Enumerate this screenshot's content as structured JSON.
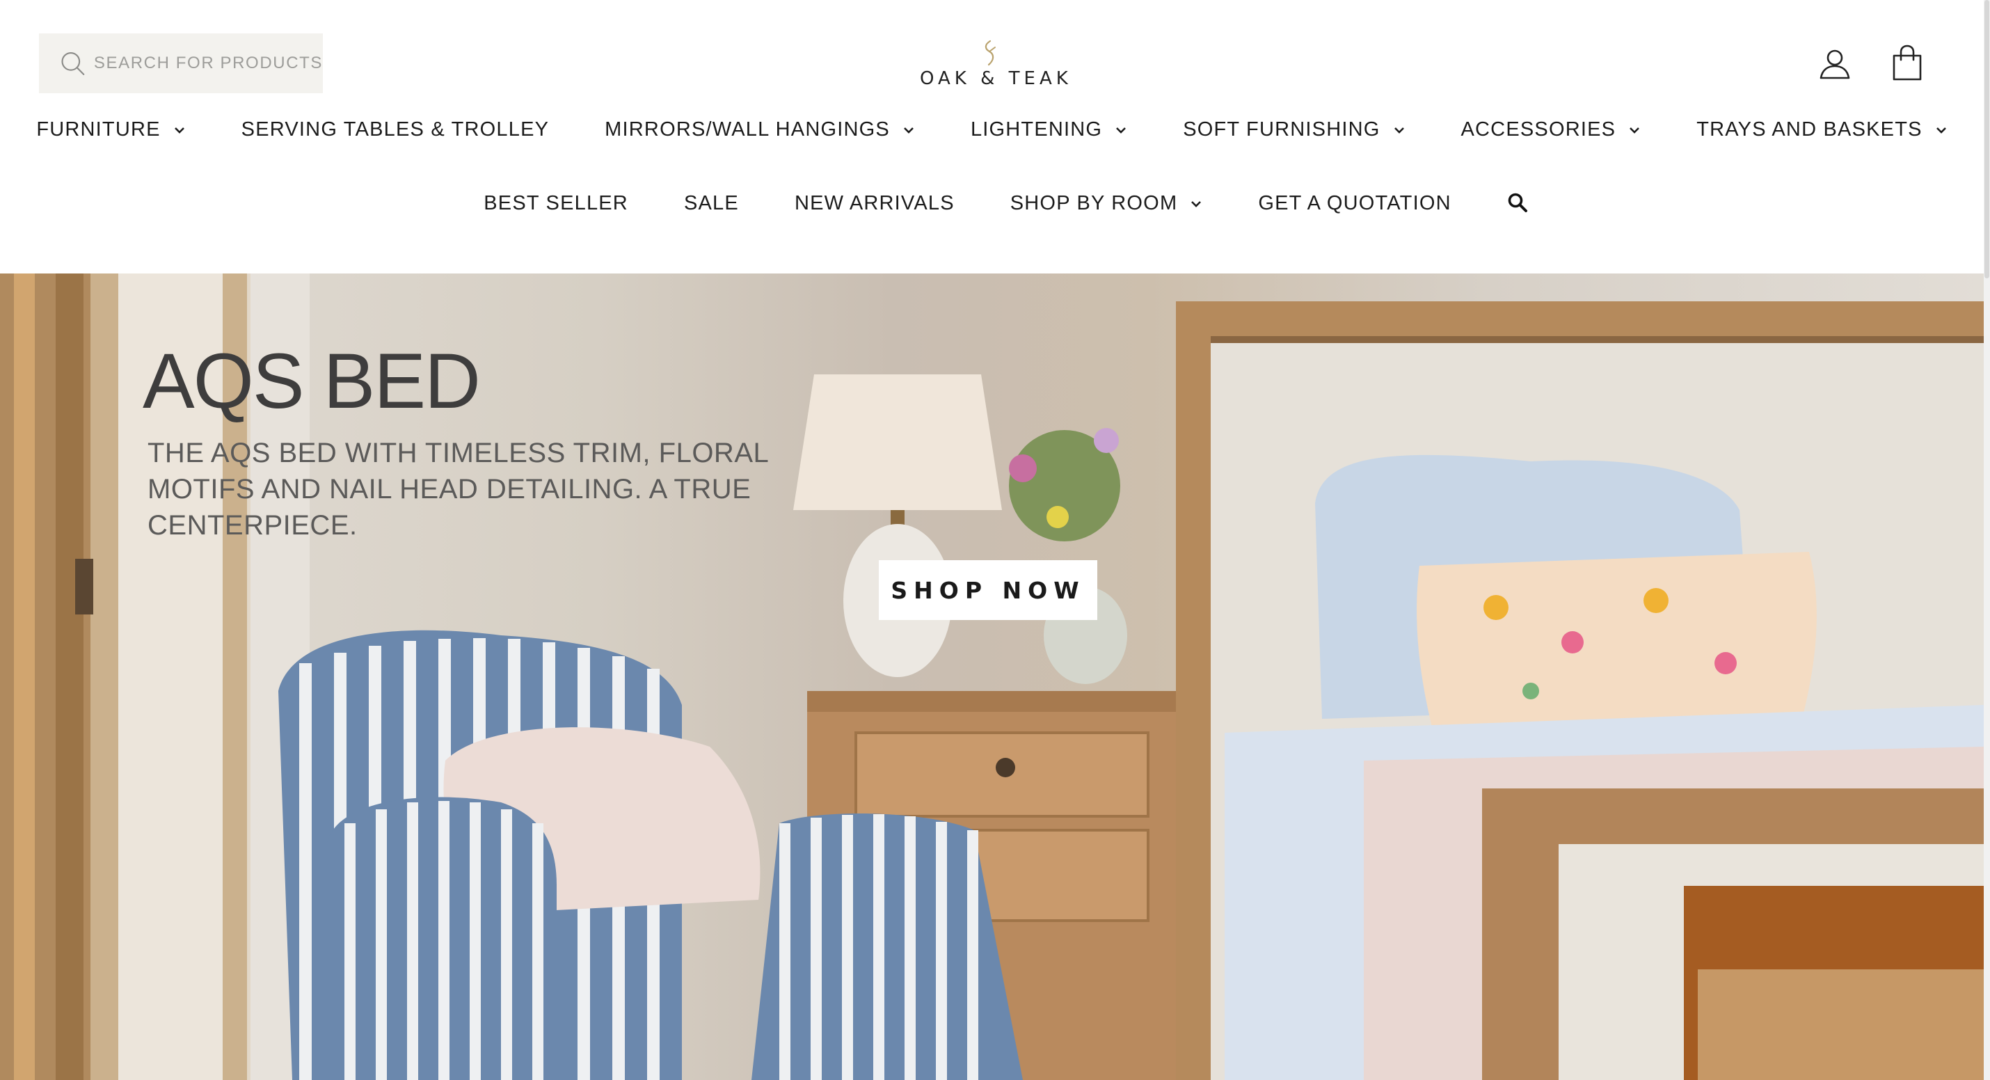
{
  "search": {
    "placeholder": "SEARCH FOR PRODUCTS"
  },
  "brand": {
    "name": "OAK & TEAK"
  },
  "nav_primary": [
    {
      "label": "FURNITURE",
      "dropdown": true
    },
    {
      "label": "SERVING TABLES & TROLLEY",
      "dropdown": false
    },
    {
      "label": "MIRRORS/WALL HANGINGS",
      "dropdown": true
    },
    {
      "label": "LIGHTENING",
      "dropdown": true
    },
    {
      "label": "SOFT FURNISHING",
      "dropdown": true
    },
    {
      "label": "ACCESSORIES",
      "dropdown": true
    },
    {
      "label": "TRAYS AND BASKETS",
      "dropdown": true
    }
  ],
  "nav_secondary": [
    {
      "label": "BEST SELLER",
      "dropdown": false
    },
    {
      "label": "SALE",
      "dropdown": false
    },
    {
      "label": "NEW ARRIVALS",
      "dropdown": false
    },
    {
      "label": "SHOP BY ROOM",
      "dropdown": true
    },
    {
      "label": "GET A QUOTATION",
      "dropdown": false
    }
  ],
  "hero": {
    "title": "AQS BED",
    "subtitle": "THE AQS BED WITH TIMELESS TRIM, FLORAL MOTIFS AND NAIL HEAD DETAILING. A TRUE CENTERPIECE.",
    "cta": "SHOP NOW"
  },
  "icons": [
    "search-icon",
    "logo-mark-icon",
    "account-icon",
    "cart-icon",
    "chevron-down-icon",
    "nav-search-icon"
  ],
  "colors": {
    "search_bg": "#f3f2ee",
    "text": "#1b1b1b",
    "hero_title": "#3e3d3d",
    "button_bg": "#ffffff"
  }
}
